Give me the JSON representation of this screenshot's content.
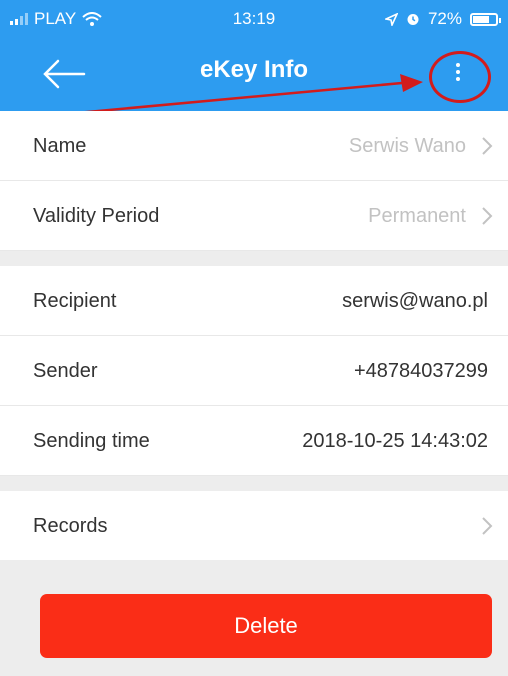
{
  "status_bar": {
    "carrier": "PLAY",
    "time": "13:19",
    "battery": "72%",
    "battery_level": 0.72,
    "icons": [
      "signal-bars-icon",
      "wifi-icon",
      "location-arrow-icon",
      "alarm-icon",
      "battery-icon"
    ]
  },
  "header": {
    "title": "eKey Info",
    "back_icon": "arrow-left-icon",
    "more_icon": "more-vertical-icon"
  },
  "details": [
    {
      "label": "Name",
      "value": "Serwis Wano",
      "chevron": true
    },
    {
      "label": "Validity Period",
      "value": "Permanent",
      "chevron": true
    }
  ],
  "info": [
    {
      "label": "Recipient",
      "value": "serwis@wano.pl"
    },
    {
      "label": "Sender",
      "value": "+48784037299"
    },
    {
      "label": "Sending time",
      "value": "2018-10-25 14:43:02"
    }
  ],
  "records": {
    "label": "Records",
    "chevron": true
  },
  "delete_label": "Delete",
  "colors": {
    "accent": "#2d9cf0",
    "delete": "#fa2d17",
    "annotation": "#d21c1c",
    "muted_text": "#c2c2c2"
  }
}
